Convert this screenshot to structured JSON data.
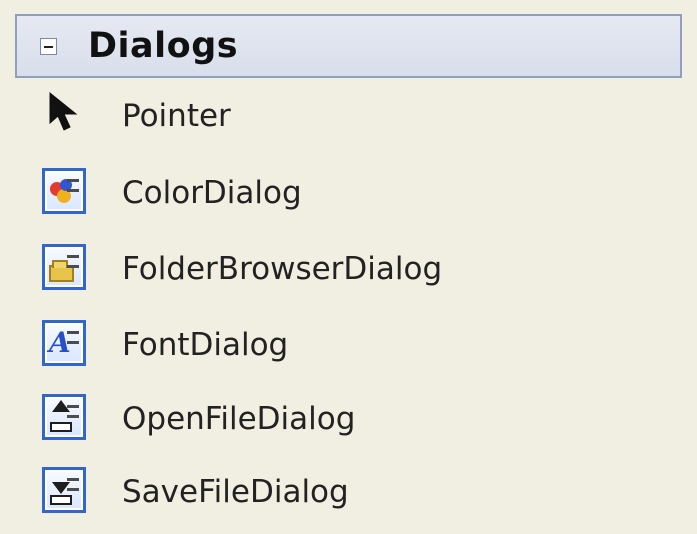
{
  "toolbox": {
    "group": {
      "title": "Dialogs",
      "expander_icon": "minus-box-icon"
    },
    "items": [
      {
        "label": "Pointer",
        "icon": "pointer-icon"
      },
      {
        "label": "ColorDialog",
        "icon": "color-dialog-icon"
      },
      {
        "label": "FolderBrowserDialog",
        "icon": "folder-browser-dialog-icon"
      },
      {
        "label": "FontDialog",
        "icon": "font-dialog-icon"
      },
      {
        "label": "OpenFileDialog",
        "icon": "open-file-dialog-icon"
      },
      {
        "label": "SaveFileDialog",
        "icon": "save-file-dialog-icon"
      }
    ],
    "colors": {
      "background": "#f1efe2",
      "header_border": "#8e9fbf",
      "icon_blue": "#3366cc"
    }
  }
}
